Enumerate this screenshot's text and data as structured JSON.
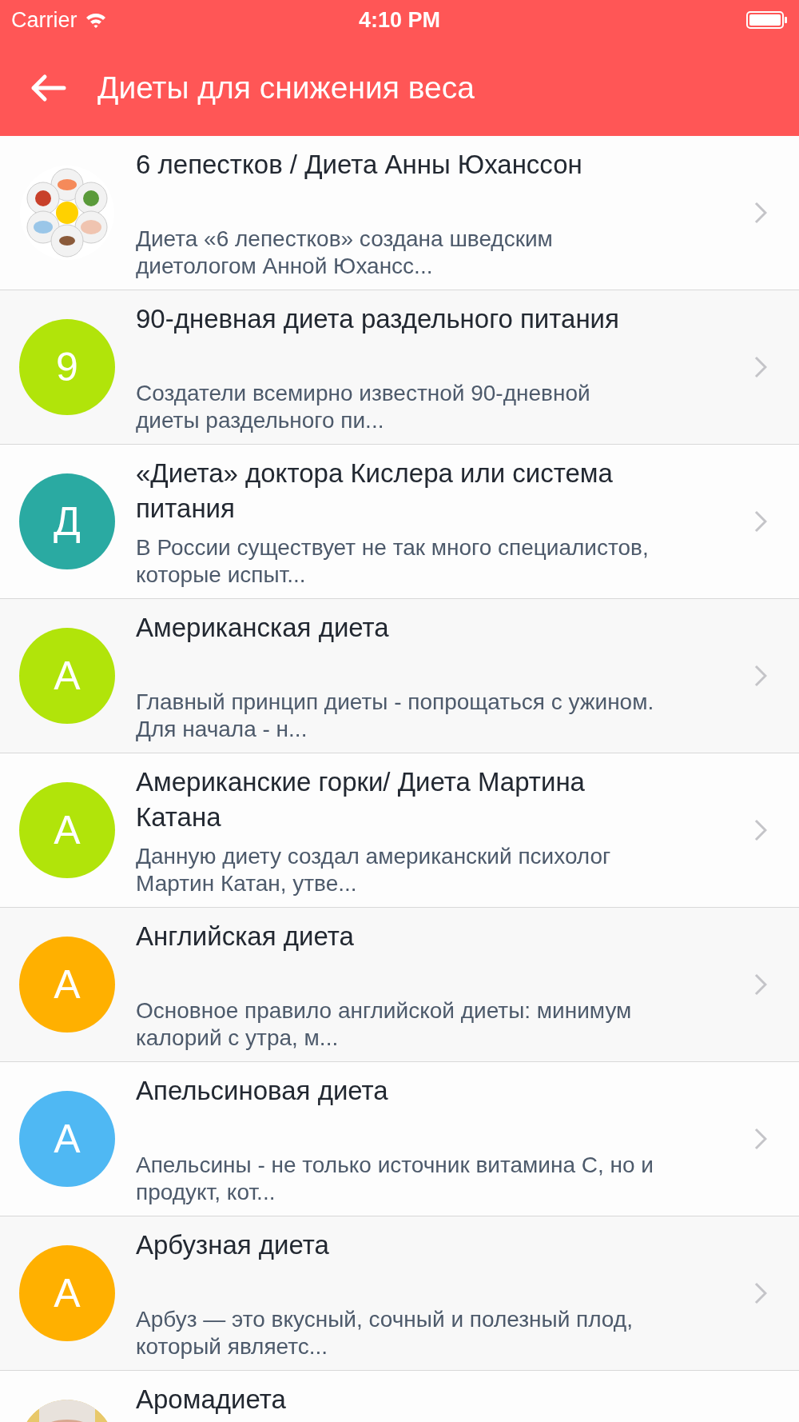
{
  "status_bar": {
    "carrier": "Carrier",
    "time": "4:10 PM"
  },
  "header": {
    "title": "Диеты для снижения веса"
  },
  "items": [
    {
      "kind": "picture",
      "title": "6 лепестков / Диета Анны Юханссон",
      "description": "Диета «6 лепестков» создана шведским диетологом Анной Юхансс..."
    },
    {
      "kind": "letter",
      "letter": "9",
      "color": "#b1e40a",
      "title": "90-дневная диета раздельного питания",
      "description": "Создатели всемирно известной 90-дневной диеты раздельного пи..."
    },
    {
      "kind": "letter",
      "letter": "Д",
      "color": "#2aaaa2",
      "title": "«Диета» доктора Кислера или система питания",
      "description": "В России существует не так много специалистов, которые испыт..."
    },
    {
      "kind": "letter",
      "letter": "А",
      "color": "#b1e40a",
      "title": "Американская диета",
      "description": "Главный принцип диеты - попрощаться с ужином. Для начала - н..."
    },
    {
      "kind": "letter",
      "letter": "А",
      "color": "#b1e40a",
      "title": "Американские горки/ Диета Мартина Катана",
      "description": "Данную диету создал американский психолог Мартин Катан, утве..."
    },
    {
      "kind": "letter",
      "letter": "А",
      "color": "#ffb000",
      "title": "Английская диета",
      "description": "Основное правило английской диеты: минимум калорий с утра, м..."
    },
    {
      "kind": "letter",
      "letter": "А",
      "color": "#4fb8f3",
      "title": "Апельсиновая диета",
      "description": "Апельсины - не только источник витамина С, но и продукт, кот..."
    },
    {
      "kind": "letter",
      "letter": "А",
      "color": "#ffb000",
      "title": "Арбузная диета",
      "description": "Арбуз — это вкусный, сочный и полезный плод, который являетс..."
    },
    {
      "kind": "picture",
      "title": "Аромадиета"
    }
  ]
}
